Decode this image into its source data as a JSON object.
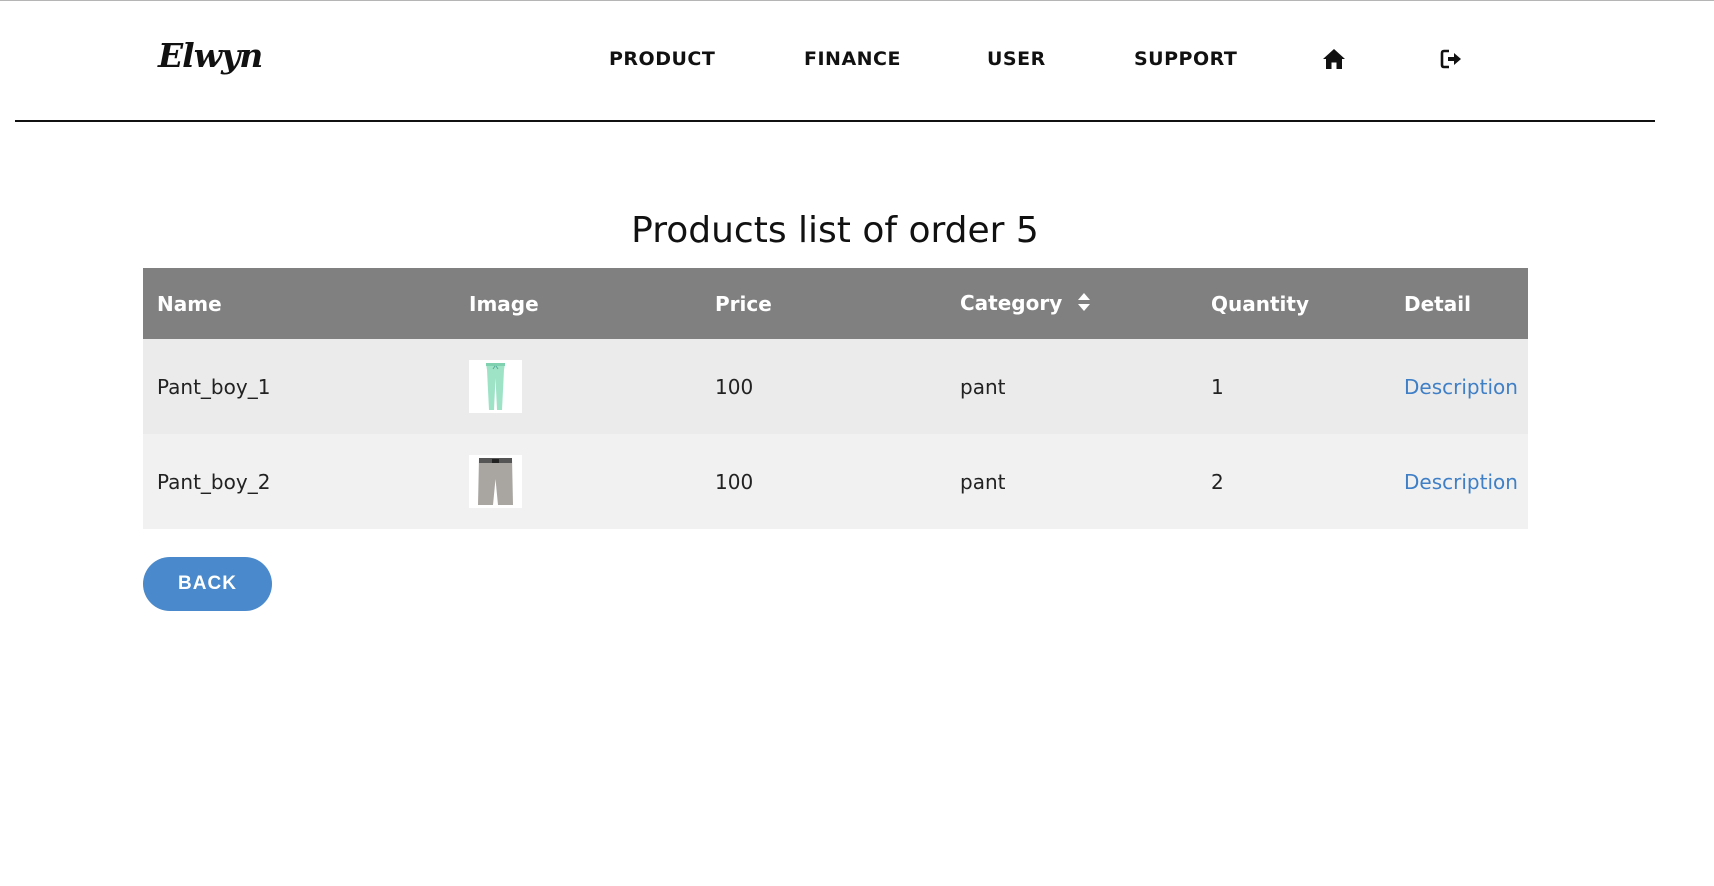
{
  "brand": {
    "logo_text": "Elwyn"
  },
  "nav": {
    "items": [
      {
        "label": "PRODUCT"
      },
      {
        "label": "FINANCE"
      },
      {
        "label": "USER"
      },
      {
        "label": "SUPPORT"
      }
    ],
    "icons": [
      "home-icon",
      "logout-icon"
    ]
  },
  "page": {
    "title": "Products list of order 5"
  },
  "table": {
    "columns": [
      "Name",
      "Image",
      "Price",
      "Category",
      "Quantity",
      "Detail"
    ],
    "sortable_column": "Category",
    "rows": [
      {
        "name": "Pant_boy_1",
        "image": "mint-green-pants-thumbnail",
        "price": "100",
        "category": "pant",
        "quantity": "1",
        "detail": "Description"
      },
      {
        "name": "Pant_boy_2",
        "image": "grey-shorts-thumbnail",
        "price": "100",
        "category": "pant",
        "quantity": "2",
        "detail": "Description"
      }
    ]
  },
  "actions": {
    "back_label": "BACK"
  },
  "colors": {
    "header_bg": "#808080",
    "row_odd": "#ebebeb",
    "row_even": "#f1f1f1",
    "link": "#3f7fc6",
    "button": "#4a89cb"
  }
}
